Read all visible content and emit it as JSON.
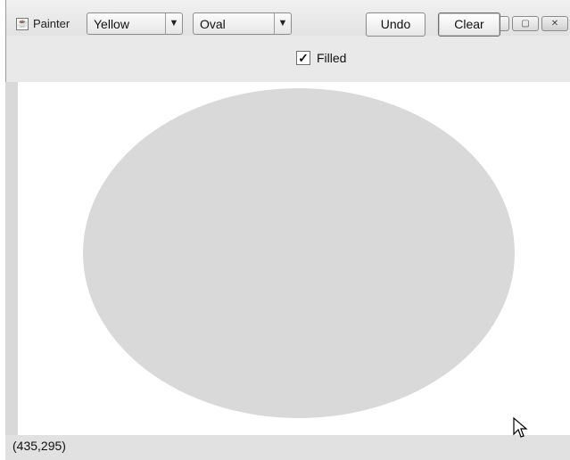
{
  "window": {
    "title": "Painter",
    "controls": [
      "minimize",
      "maximize",
      "close"
    ]
  },
  "toolbar": {
    "color_select": {
      "selected": "Yellow"
    },
    "shape_select": {
      "selected": "Oval"
    },
    "filled_checkbox": {
      "label": "Filled",
      "checked": true
    },
    "undo_label": "Undo",
    "clear_label": "Clear"
  },
  "canvas": {
    "shapes": [
      {
        "type": "oval",
        "filled": true,
        "color": "#d9d9d9"
      }
    ]
  },
  "status": {
    "coordinates": "(435,295)"
  },
  "icons": {
    "app": "java-cup-icon",
    "cursor": "mouse-pointer-icon"
  }
}
